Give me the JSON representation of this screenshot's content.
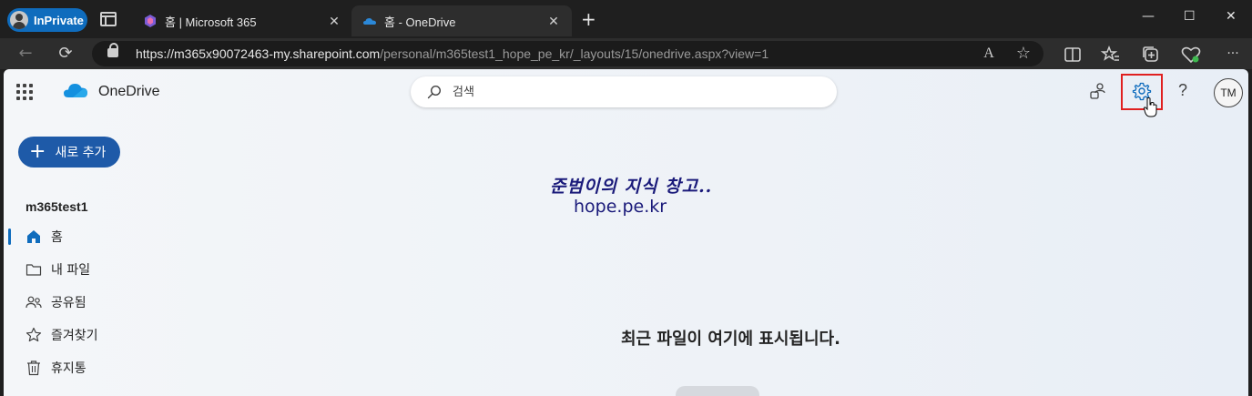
{
  "browser": {
    "inprivate_label": "InPrivate",
    "tabs": [
      {
        "title": "홈 | Microsoft 365",
        "close": "✕"
      },
      {
        "title": "홈 - OneDrive",
        "close": "✕"
      }
    ],
    "new_tab": "+",
    "window_controls": {
      "minimize": "—",
      "maximize": "☐",
      "close": "✕"
    },
    "url_host": "https://m365x90072463-my.sharepoint.com",
    "url_path": "/personal/m365test1_hope_pe_kr/_layouts/15/onedrive.aspx?view=1",
    "nav": {
      "back": "←",
      "refresh": "⟳"
    },
    "toolbar": {
      "read_aloud": "A",
      "favorite": "☆",
      "more": "···"
    }
  },
  "app": {
    "name": "OneDrive",
    "search_placeholder": "검색",
    "help": "?",
    "avatar_initials": "TM",
    "new_button": "새로 추가",
    "new_button_plus": "+",
    "user_section": "m365test1",
    "nav": [
      {
        "label": "홈",
        "icon": "home-icon",
        "active": true
      },
      {
        "label": "내 파일",
        "icon": "folder-icon"
      },
      {
        "label": "공유됨",
        "icon": "people-icon"
      },
      {
        "label": "즐겨찾기",
        "icon": "star-icon"
      },
      {
        "label": "휴지통",
        "icon": "trash-icon"
      }
    ],
    "watermark_line1": "준범이의 지식 창고..",
    "watermark_line2": "hope.pe.kr",
    "empty_message": "최근 파일이 여기에 표시됩니다."
  },
  "colors": {
    "accent": "#0f6cbd",
    "highlight": "#e02020",
    "new_button": "#1e5aa8"
  }
}
